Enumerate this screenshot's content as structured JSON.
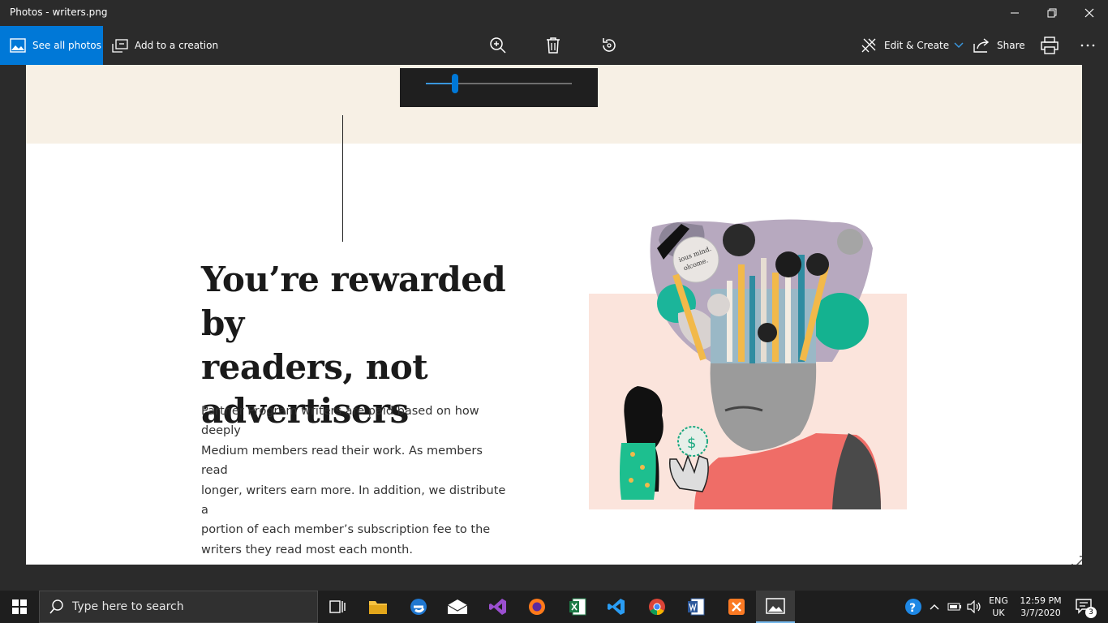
{
  "window": {
    "title": "Photos - writers.png"
  },
  "toolbar": {
    "see_all_photos": "See all photos",
    "add_to_creation": "Add to a creation",
    "edit_create": "Edit & Create",
    "share": "Share"
  },
  "zoom": {
    "level": 0.2
  },
  "article": {
    "headline_line1": "You’re rewarded by",
    "headline_line2": "readers, not",
    "headline_line3": "advertisers",
    "body_line1": "Partner Program writers are paid based on how deeply",
    "body_line2": "Medium members read their work. As members read",
    "body_line3": "longer, writers earn more. In addition, we distribute a",
    "body_line4": "portion of each member’s subscription fee to the",
    "body_line5": "writers they read most each month."
  },
  "illustration": {
    "text_a": "ious mind.",
    "text_b": "olcome.",
    "icon": "dollar-coin-icon"
  },
  "taskbar": {
    "search_placeholder": "Type here to search",
    "lang_top": "ENG",
    "lang_bottom": "UK",
    "time": "12:59 PM",
    "date": "3/7/2020",
    "notification_count": "3"
  },
  "colors": {
    "accent": "#0078d7",
    "band": "#f7f0e5",
    "titlebar": "#2b2b2b"
  }
}
